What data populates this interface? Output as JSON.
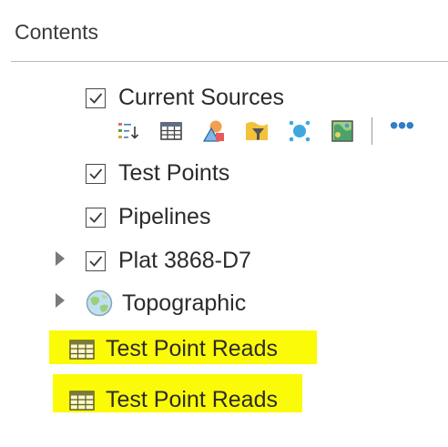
{
  "panel": {
    "title": "Contents"
  },
  "layers": [
    {
      "label": "Current Sources",
      "checked": true
    },
    {
      "label": "Test Points",
      "checked": true
    },
    {
      "label": "Pipelines",
      "checked": true
    },
    {
      "label": "Plat 3868-D7",
      "checked": true,
      "expandable": true
    },
    {
      "label": "Topographic",
      "basemap": true,
      "expandable": true
    }
  ],
  "tables": [
    {
      "label": "Test Point Reads",
      "highlighted": true
    },
    {
      "label": "Test Point Reads",
      "highlighted": true
    }
  ],
  "toolbar": {
    "tools": [
      "show-legend-icon",
      "attribute-table-icon",
      "change-style-icon",
      "filter-icon",
      "analysis-icon",
      "raster-function-icon"
    ],
    "more_label": "•••"
  },
  "colors": {
    "highlight": "#fbfb07",
    "accent": "#2f7fc5"
  }
}
